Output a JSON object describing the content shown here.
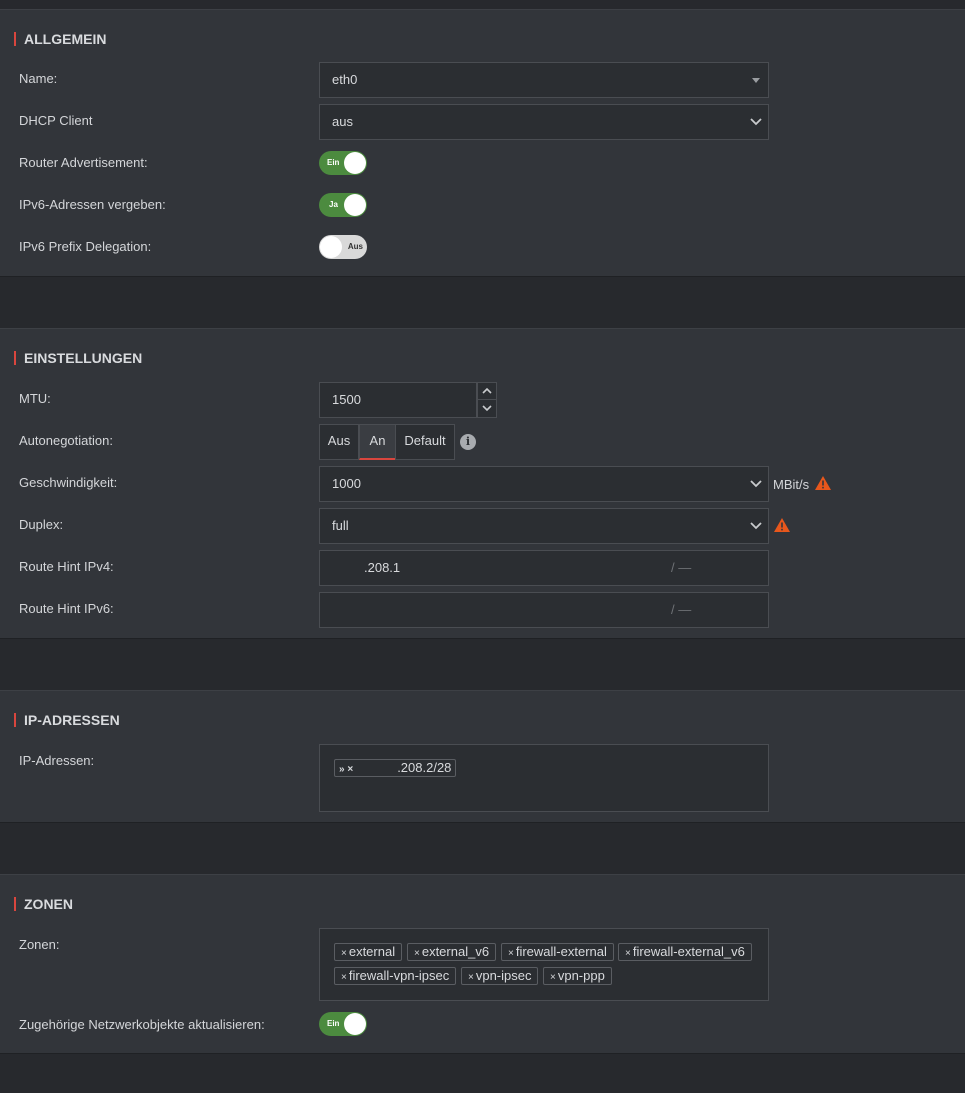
{
  "allgemein": {
    "title": "ALLGEMEIN",
    "name_label": "Name:",
    "name_value": "eth0",
    "dhcp_label": "DHCP Client",
    "dhcp_value": "aus",
    "router_adv_label": "Router Advertisement:",
    "router_adv_toggle": "Ein",
    "ipv6_addr_label": "IPv6-Adressen vergeben:",
    "ipv6_addr_toggle": "Ja",
    "ipv6_prefix_label": "IPv6 Prefix Delegation:",
    "ipv6_prefix_toggle": "Aus"
  },
  "einstellungen": {
    "title": "EINSTELLUNGEN",
    "mtu_label": "MTU:",
    "mtu_value": "1500",
    "autoneg_label": "Autonegotiation:",
    "autoneg_options": [
      "Aus",
      "An",
      "Default"
    ],
    "autoneg_selected": "An",
    "speed_label": "Geschwindigkeit:",
    "speed_value": "1000",
    "speed_unit": "MBit/s",
    "duplex_label": "Duplex:",
    "duplex_value": "full",
    "route_v4_label": "Route Hint IPv4:",
    "route_v4_value": ".208.1",
    "route_v4_suffix": "/ —",
    "route_v6_label": "Route Hint IPv6:",
    "route_v6_suffix": "/ —"
  },
  "ip_adressen": {
    "title": "IP-ADRESSEN",
    "label": "IP-Adressen:",
    "tag_prefix": "» ×",
    "tag_value": ".208.2/28"
  },
  "zonen": {
    "title": "ZONEN",
    "label": "Zonen:",
    "tags": [
      "external",
      "external_v6",
      "firewall-external",
      "firewall-external_v6",
      "firewall-vpn-ipsec",
      "vpn-ipsec",
      "vpn-ppp"
    ],
    "update_label": "Zugehörige Netzwerkobjekte aktualisieren:",
    "update_toggle": "Ein"
  },
  "colors": {
    "accent": "#d9463e",
    "toggle_on": "#4c8b3f",
    "warning": "#e8571c"
  },
  "icons": [
    "chevron-down-icon",
    "caret-down-icon",
    "info-icon",
    "warning-icon",
    "spinner-up-icon",
    "spinner-down-icon",
    "close-icon",
    "expand-icon"
  ]
}
